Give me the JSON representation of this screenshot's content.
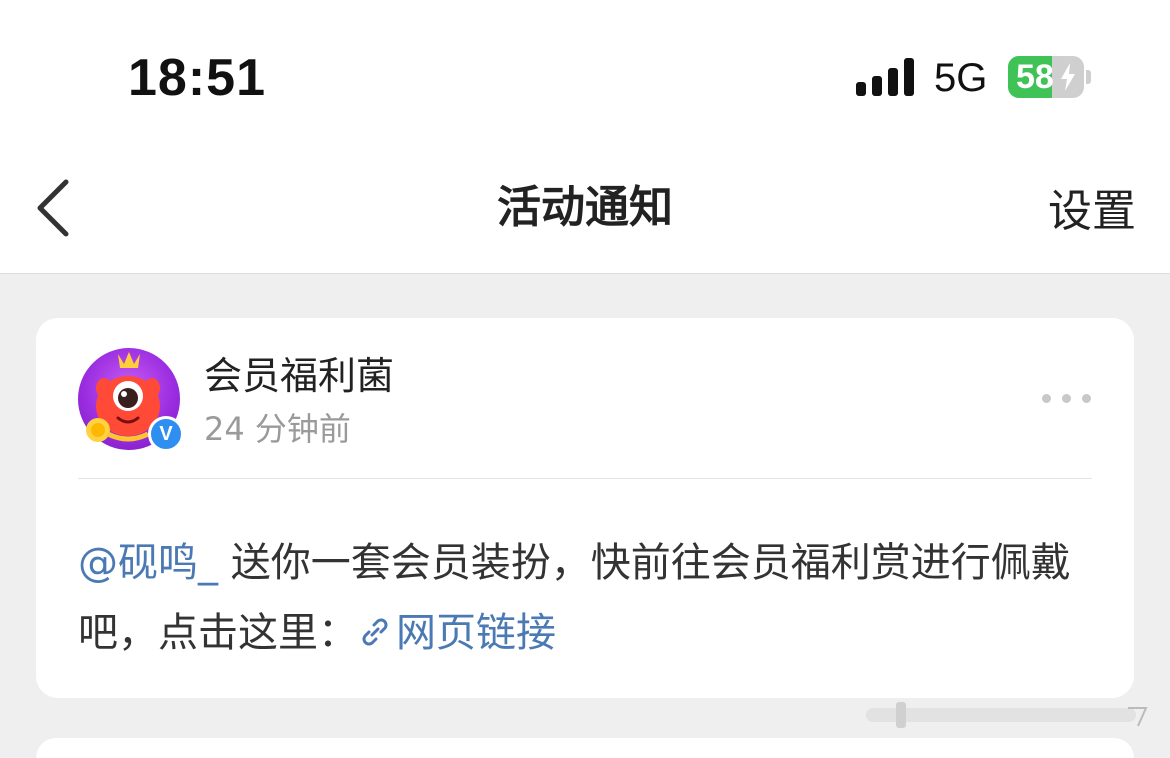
{
  "status_bar": {
    "time": "18:51",
    "network": "5G",
    "battery_level": "58",
    "battery_fraction": 0.58,
    "signal_icon": "signal-bars-icon",
    "charging_icon": "bolt-icon"
  },
  "nav": {
    "title": "活动通知",
    "settings_label": "设置",
    "back_icon": "chevron-left-icon"
  },
  "notification": {
    "author": "会员福利菌",
    "time": "24 分钟前",
    "verified_badge": "V",
    "more_icon": "more-dots-icon",
    "mention": "@砚鸣_",
    "message": " 送你一套会员装扮，快前往会员福利赏进行佩戴吧，点击这里：",
    "link_label": "网页链接",
    "link_icon": "link-icon",
    "link_color": "#4a79b4"
  },
  "colors": {
    "battery_green": "#3fc356",
    "badge_blue": "#2f8ff0",
    "page_background": "#efefef"
  }
}
